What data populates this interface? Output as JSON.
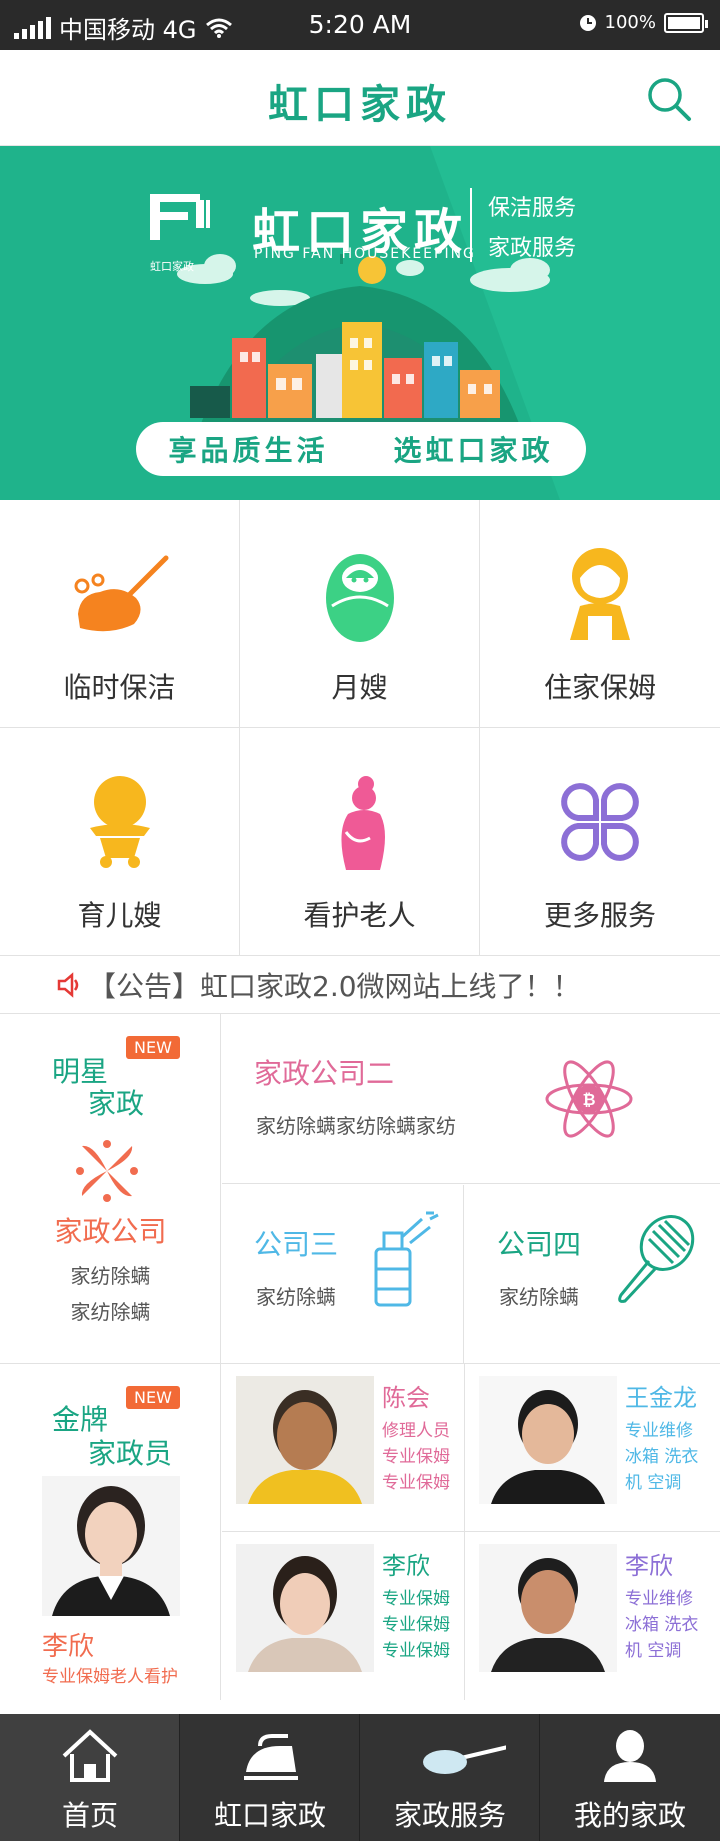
{
  "status_bar": {
    "carrier": "中国移动 4G",
    "time": "5:20 AM",
    "battery": "100%"
  },
  "header": {
    "title": "虹口家政",
    "search_icon": "search-icon"
  },
  "banner": {
    "logo_text": "虹口家政",
    "brand": "虹口家政",
    "brand_en": "PING FAN HOUSEKEEPING",
    "service1": "保洁服务",
    "service2": "家政服务",
    "slogan_left": "享品质生活",
    "slogan_right": "选虹口家政",
    "bg_color": "#1fb38b"
  },
  "services": [
    {
      "label": "临时保洁",
      "icon": "broom-icon",
      "color": "#f5831f"
    },
    {
      "label": "月嫂",
      "icon": "baby-wrap-icon",
      "color": "#3cd185"
    },
    {
      "label": "住家保姆",
      "icon": "nanny-icon",
      "color": "#f7b71e"
    },
    {
      "label": "育儿嫂",
      "icon": "toddler-icon",
      "color": "#f7b71e"
    },
    {
      "label": "看护老人",
      "icon": "elder-care-icon",
      "color": "#ef5a96"
    },
    {
      "label": "更多服务",
      "icon": "more-services-icon",
      "color": "#8c6fd6"
    }
  ],
  "notice": {
    "text": "【公告】虹口家政2.0微网站上线了！！"
  },
  "star": {
    "title1": "明星",
    "title2": "家政",
    "badge": "NEW",
    "company_name": "家政公司",
    "company_line1": "家纺除螨",
    "company_line2": "家纺除螨",
    "co2_name": "家政公司二",
    "co2_desc": "家纺除螨家纺除螨家纺",
    "co3_name": "公司三",
    "co3_desc": "家纺除螨",
    "co4_name": "公司四",
    "co4_desc": "家纺除螨"
  },
  "gold": {
    "title1": "金牌",
    "title2": "家政员",
    "badge": "NEW",
    "featured_name": "李欣",
    "featured_desc": "专业保姆老人看护",
    "staff": [
      {
        "name": "陈会",
        "lines": [
          "修理人员",
          "专业保姆",
          "专业保姆"
        ],
        "color": "#e06a98"
      },
      {
        "name": "王金龙",
        "lines": [
          "专业维修",
          "冰箱 洗衣",
          "机 空调"
        ],
        "color": "#4fb8e6"
      },
      {
        "name": "李欣",
        "lines": [
          "专业保姆",
          "专业保姆",
          "专业保姆"
        ],
        "color": "#1aa583"
      },
      {
        "name": "李欣",
        "lines": [
          "专业维修",
          "冰箱 洗衣",
          "机 空调"
        ],
        "color": "#8c6fd6"
      }
    ]
  },
  "bottom_nav": [
    {
      "label": "首页",
      "icon": "home-icon"
    },
    {
      "label": "虹口家政",
      "icon": "iron-icon"
    },
    {
      "label": "家政服务",
      "icon": "mop-icon"
    },
    {
      "label": "我的家政",
      "icon": "user-icon"
    }
  ]
}
